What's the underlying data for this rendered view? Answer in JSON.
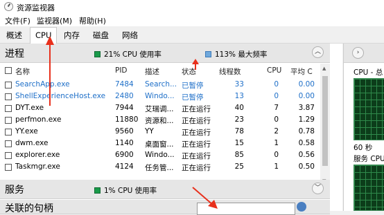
{
  "window": {
    "title": "资源监视器"
  },
  "menu": [
    "文件(F)",
    "监视器(M)",
    "帮助(H)"
  ],
  "tabs": [
    "概述",
    "CPU",
    "内存",
    "磁盘",
    "网络"
  ],
  "active_tab": "CPU",
  "colors": {
    "cpu_meter": "#1a9a4a",
    "freq_meter": "#6fa8dc",
    "suspended_text": "#1e6fc8",
    "annotation_arrow": "#e8301c"
  },
  "processes": {
    "title": "进程",
    "cpu_usage": "21% CPU 使用率",
    "max_freq": "113% 最大频率",
    "columns": {
      "name": "名称",
      "pid": "PID",
      "desc": "描述",
      "status": "状态",
      "threads": "线程数",
      "cpu": "CPU",
      "avg": "平均 C"
    },
    "rows": [
      {
        "name": "SearchApp.exe",
        "pid": "7484",
        "desc": "Search...",
        "status": "已暂停",
        "threads": "33",
        "cpu": "0",
        "avg": "0.00",
        "suspended": true
      },
      {
        "name": "ShellExperienceHost.exe",
        "pid": "2480",
        "desc": "Windo...",
        "status": "已暂停",
        "threads": "13",
        "cpu": "0",
        "avg": "0.00",
        "suspended": true
      },
      {
        "name": "DYT.exe",
        "pid": "7944",
        "desc": "艾瑞调...",
        "status": "正在运行",
        "threads": "40",
        "cpu": "7",
        "avg": "3.87"
      },
      {
        "name": "perfmon.exe",
        "pid": "11880",
        "desc": "资源和...",
        "status": "正在运行",
        "threads": "23",
        "cpu": "0",
        "avg": "1.29"
      },
      {
        "name": "YY.exe",
        "pid": "9560",
        "desc": "YY",
        "status": "正在运行",
        "threads": "78",
        "cpu": "2",
        "avg": "0.78"
      },
      {
        "name": "dwm.exe",
        "pid": "1140",
        "desc": "桌面窗...",
        "status": "正在运行",
        "threads": "15",
        "cpu": "1",
        "avg": "0.58"
      },
      {
        "name": "explorer.exe",
        "pid": "6900",
        "desc": "Windo...",
        "status": "正在运行",
        "threads": "85",
        "cpu": "0",
        "avg": "0.56"
      },
      {
        "name": "Taskmgr.exe",
        "pid": "4124",
        "desc": "任务管...",
        "status": "正在运行",
        "threads": "25",
        "cpu": "1",
        "avg": "0.50"
      }
    ]
  },
  "services": {
    "title": "服务",
    "cpu_usage": "1% CPU 使用率"
  },
  "handles": {
    "title": "关联的句柄"
  },
  "right_panel": {
    "cpu_title": "CPU - 总",
    "time_label": "60 秒",
    "service_label": "服务 CPU"
  }
}
